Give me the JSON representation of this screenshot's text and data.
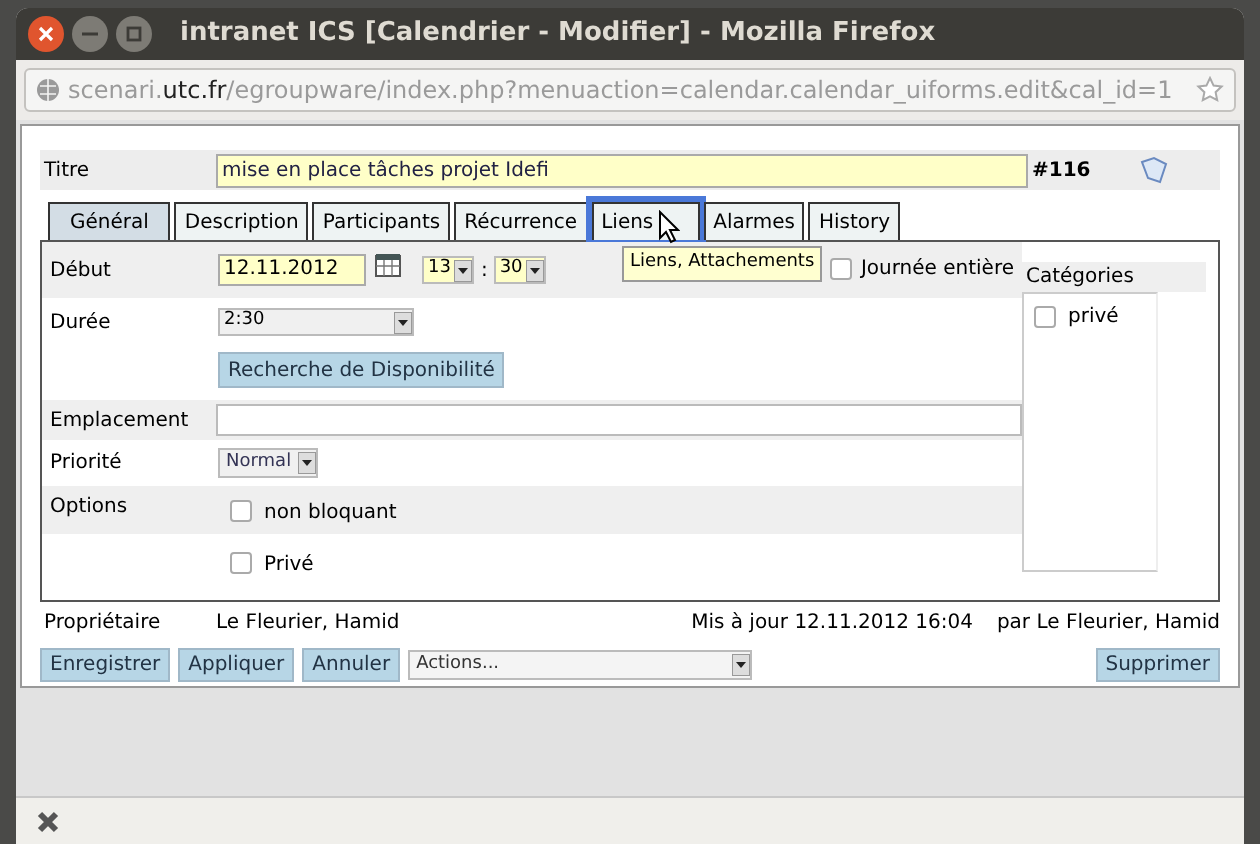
{
  "window": {
    "title": "intranet ICS [Calendrier - Modifier] - Mozilla Firefox"
  },
  "url": {
    "prefix": "scenari.",
    "domain": "utc.fr",
    "path": "/egroupware/index.php?menuaction=calendar.calendar_uiforms.edit&cal_id=1"
  },
  "form": {
    "title_label": "Titre",
    "title_value": "mise en place tâches projet Idefi",
    "id": "#116"
  },
  "tabs": [
    {
      "label": "Général",
      "selected": true,
      "hovered": false
    },
    {
      "label": "Description",
      "selected": false,
      "hovered": false
    },
    {
      "label": "Participants",
      "selected": false,
      "hovered": false
    },
    {
      "label": "Récurrence",
      "selected": false,
      "hovered": false
    },
    {
      "label": "Liens",
      "selected": false,
      "hovered": true
    },
    {
      "label": "Alarmes",
      "selected": false,
      "hovered": false
    },
    {
      "label": "History",
      "selected": false,
      "hovered": false
    }
  ],
  "tooltip": "Liens, Attachements",
  "start": {
    "label": "Début",
    "date": "12.11.2012",
    "hour": "13",
    "separator": ":",
    "minute": "30"
  },
  "all_day": {
    "label": "Journée entière",
    "checked": false
  },
  "duration": {
    "label": "Durée",
    "value": "2:30"
  },
  "availability_button": "Recherche de Disponibilité",
  "location": {
    "label": "Emplacement"
  },
  "priority": {
    "label": "Priorité",
    "value": "Normal"
  },
  "options": {
    "label": "Options",
    "items": [
      {
        "label": "non bloquant",
        "checked": false
      },
      {
        "label": "Privé",
        "checked": false
      }
    ]
  },
  "categories": {
    "label": "Catégories",
    "items": [
      {
        "label": "privé",
        "checked": false
      }
    ]
  },
  "footer": {
    "owner_label": "Propriétaire",
    "owner": "Le Fleurier, Hamid",
    "updated": "Mis à jour 12.11.2012 16:04",
    "updated_by": "par Le Fleurier, Hamid"
  },
  "buttons": [
    "Enregistrer",
    "Appliquer",
    "Annuler"
  ],
  "actions": {
    "value": "Actions..."
  },
  "delete_button": "Supprimer"
}
